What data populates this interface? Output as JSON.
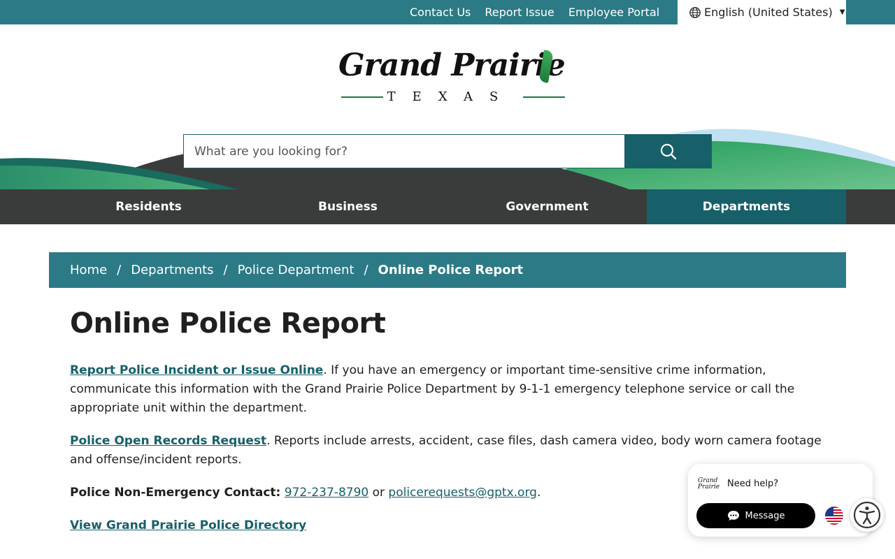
{
  "topbar": {
    "links": [
      "Contact Us",
      "Report Issue",
      "Employee Portal"
    ],
    "language": "English (United States)"
  },
  "logo": {
    "wordmark": "Grand Prairie",
    "subtitle": "TEXAS"
  },
  "search": {
    "placeholder": "What are you looking for?"
  },
  "nav": {
    "items": [
      "Residents",
      "Business",
      "Government",
      "Departments"
    ],
    "active": "Departments"
  },
  "breadcrumb": {
    "items": [
      "Home",
      "Departments",
      "Police Department"
    ],
    "current": "Online Police Report"
  },
  "page": {
    "title": "Online Police Report",
    "p1_link": "Report Police Incident or Issue Online",
    "p1_text": ". If you have an emergency or important time-sensitive crime information, communicate this information with the Grand Prairie Police Department by 9-1-1 emergency telephone service or call the appropriate unit within the department.",
    "p2_link": "Police Open Records Request",
    "p2_text": ". Reports include arrests, accident, case files, dash camera video, body worn camera footage and offense/incident reports.",
    "p3_label": "Police Non-Emergency Contact:",
    "p3_phone": "972-237-8790",
    "p3_or": " or ",
    "p3_email": "policerequests@gptx.org",
    "p3_end": ".",
    "p4_link": "View Grand Prairie Police Directory"
  },
  "chat": {
    "prompt": "Need help?",
    "button": "Message"
  },
  "colors": {
    "teal": "#2b7a86",
    "dark_teal": "#17606a",
    "nav_bg": "#3a3c3c",
    "green": "#1b9a5a"
  }
}
